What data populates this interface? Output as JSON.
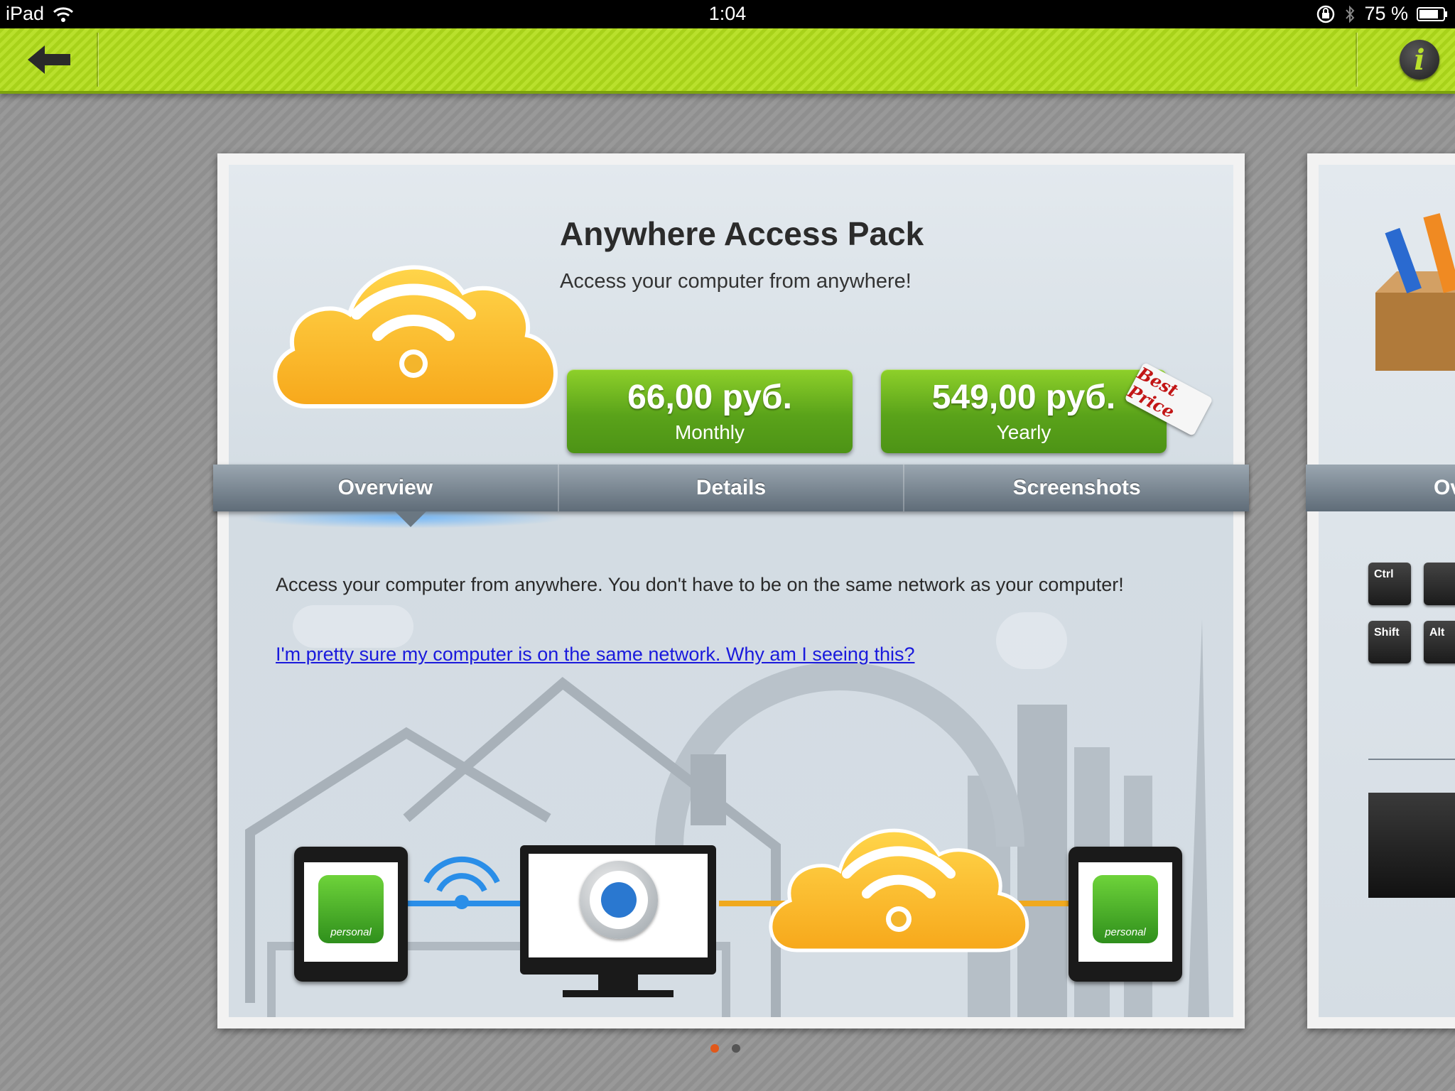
{
  "status_bar": {
    "device": "iPad",
    "time": "1:04",
    "battery": "75 %"
  },
  "toolbar": {
    "back_icon": "back-arrow-icon",
    "info_label": "i"
  },
  "product": {
    "title": "Anywhere Access Pack",
    "subtitle": "Access your computer from anywhere!",
    "monthly_price": "66,00 руб.",
    "monthly_label": "Monthly",
    "yearly_price": "549,00 руб.",
    "yearly_label": "Yearly",
    "badge": "Best Price"
  },
  "tabs": [
    {
      "label": "Overview",
      "selected": true
    },
    {
      "label": "Details",
      "selected": false
    },
    {
      "label": "Screenshots",
      "selected": false
    }
  ],
  "overview": {
    "description": "Access your computer from anywhere. You don't have to be on the same network as your computer!",
    "help_link": "I'm pretty sure my computer is on the same network. Why am I seeing this?",
    "device_label_left": "personal",
    "device_label_right": "personal"
  },
  "next_card": {
    "tab_label": "Ov",
    "keys": [
      "Ctrl",
      "Shift",
      "Alt"
    ]
  },
  "pagination": {
    "pages": 2,
    "current": 1
  },
  "colors": {
    "toolbar": "#b9e02c",
    "price_button": "#5aa31a",
    "tab_bar": "#6a7782",
    "link": "#1a1adc",
    "page_dot_active": "#e1581a"
  }
}
